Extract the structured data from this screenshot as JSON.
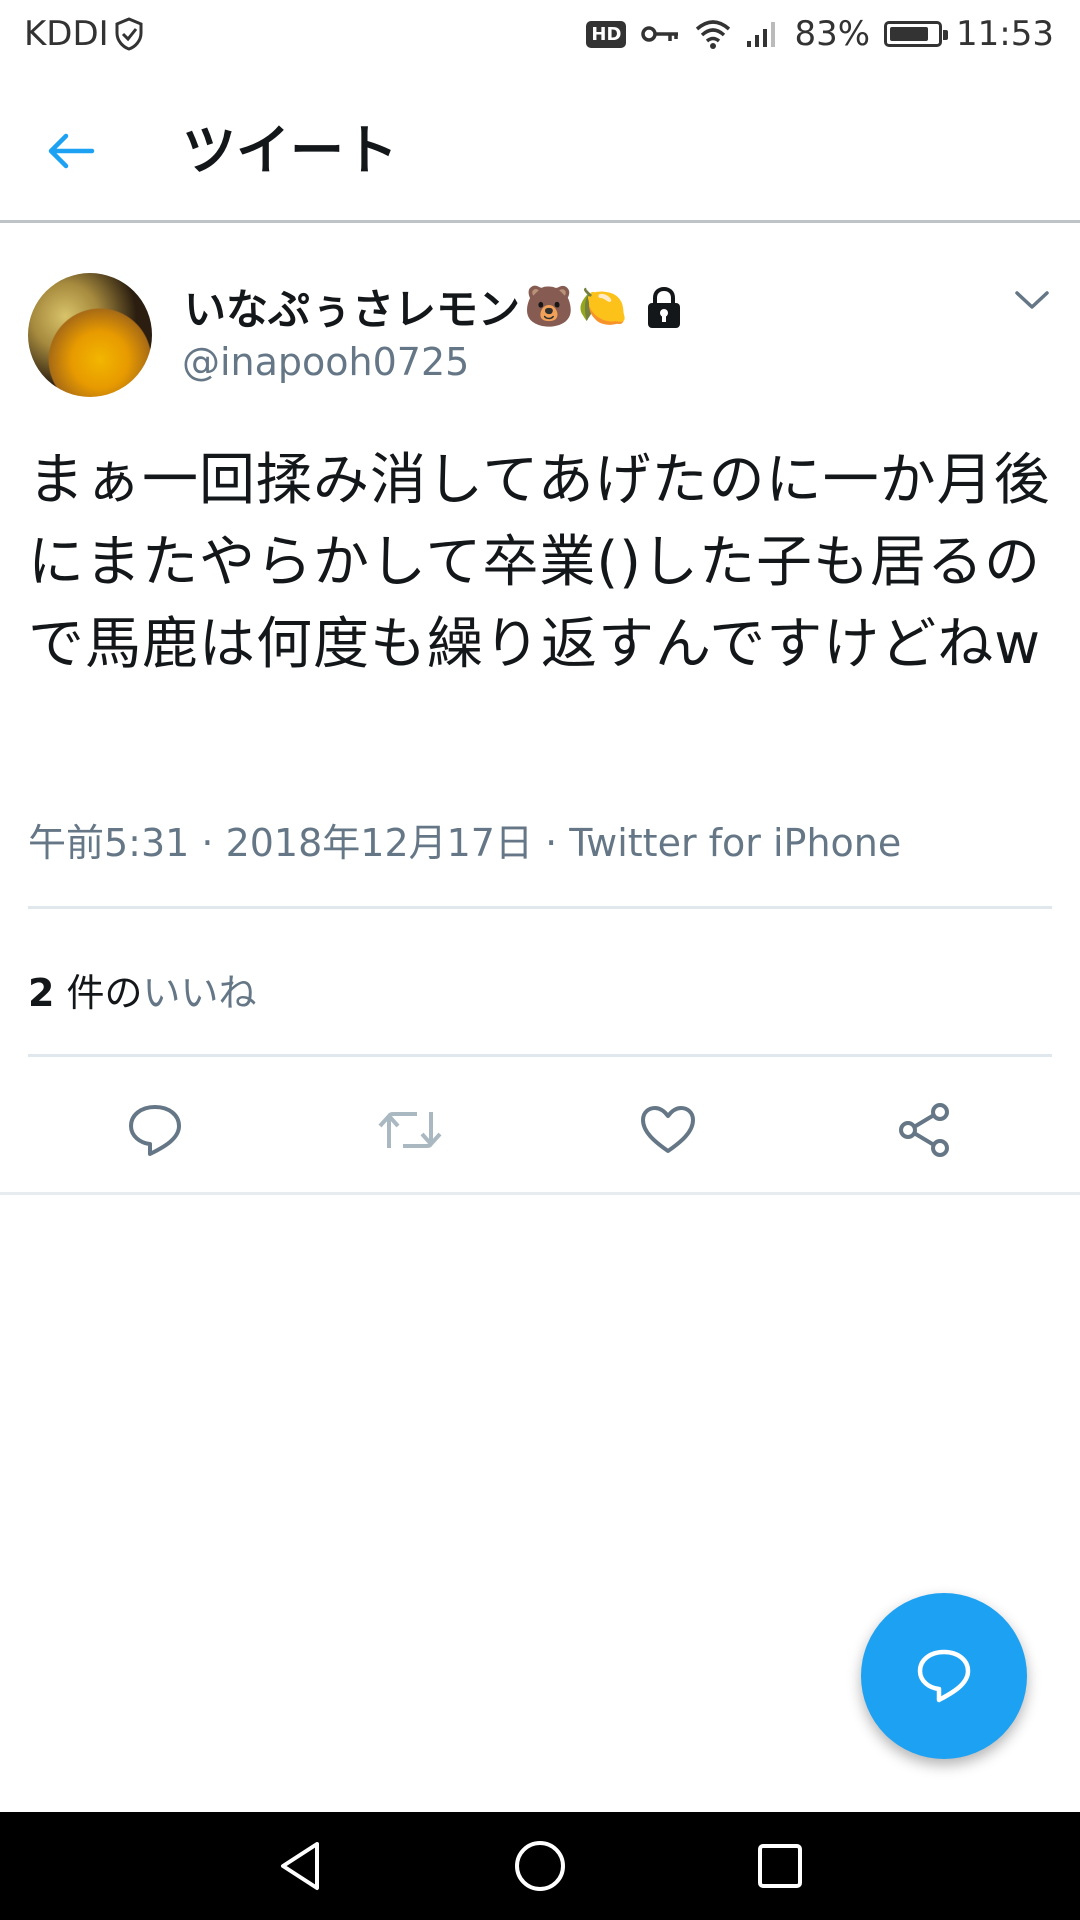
{
  "status_bar": {
    "carrier": "KDDI",
    "hd_badge": "HD",
    "battery": "83%",
    "battery_level": 0.83,
    "time": "11:53"
  },
  "header": {
    "title": "ツイート"
  },
  "tweet": {
    "author_name": "いなぷぅさレモン",
    "author_emojis": [
      "🐻",
      "🍋"
    ],
    "handle": "@inapooh0725",
    "text": "まぁ一回揉み消してあげたのに一か月後にまたやらかして卒業()した子も居るので馬鹿は何度も繰り返すんですけどねw",
    "meta": "午前5:31 · 2018年12月17日 · Twitter for iPhone",
    "likes_count": "2",
    "likes_label": " 件の",
    "likes_link": "いいね"
  },
  "icons": {
    "back": "arrow-left-icon",
    "caret": "chevron-down-icon",
    "reply": "reply-icon",
    "retweet": "retweet-icon",
    "like": "heart-icon",
    "share": "share-icon",
    "compose": "compose-reply-icon"
  },
  "colors": {
    "accent": "#1da1f2",
    "text": "#14171a",
    "secondary": "#657786"
  }
}
